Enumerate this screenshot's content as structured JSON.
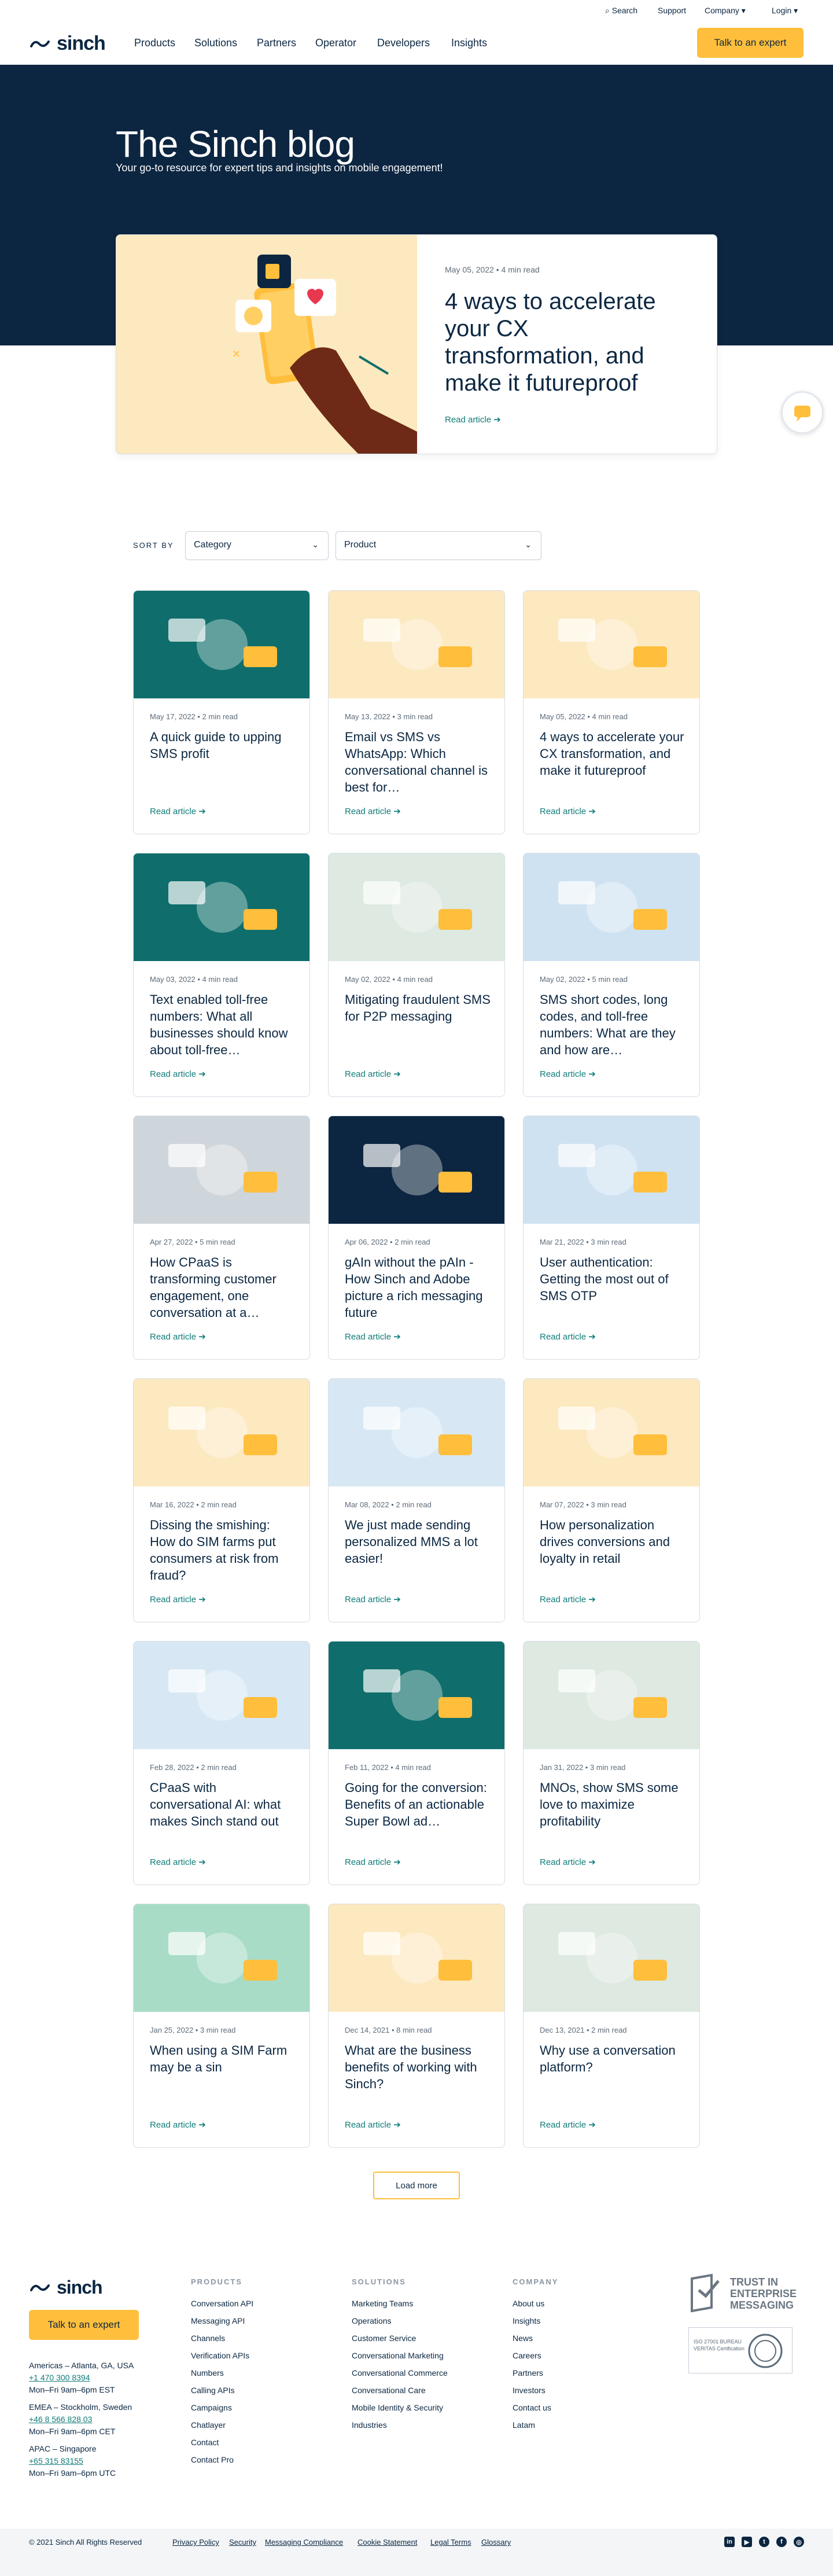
{
  "header": {
    "brand": "sinch",
    "utility": {
      "search": "Search",
      "support": "Support",
      "company": "Company",
      "login": "Login"
    },
    "nav": [
      "Products",
      "Solutions",
      "Partners",
      "Operator",
      "Developers",
      "Insights"
    ],
    "cta": "Talk to an expert"
  },
  "hero": {
    "title": "The Sinch blog",
    "subtitle": "Your go-to resource for expert tips and insights on mobile engagement!",
    "featured": {
      "meta": "May 05, 2022 • 4 min read",
      "title": "4 ways to accelerate your CX transformation, and make it futureproof",
      "read": "Read article"
    }
  },
  "sort": {
    "label": "SORT BY",
    "category": "Category",
    "product": "Product"
  },
  "cards": [
    {
      "meta": "May 17, 2022 • 2 min read",
      "title": "A quick guide to upping SMS profit",
      "read": "Read article",
      "bg": "#0f6e6b"
    },
    {
      "meta": "May 13, 2022 • 3 min read",
      "title": "Email vs SMS vs WhatsApp: Which conversational channel is best for…",
      "read": "Read article",
      "bg": "#fde9c0"
    },
    {
      "meta": "May 05, 2022 • 4 min read",
      "title": "4 ways to accelerate your CX transformation, and make it futureproof",
      "read": "Read article",
      "bg": "#fde9c0"
    },
    {
      "meta": "May 03, 2022 • 4 min read",
      "title": "Text enabled toll-free numbers: What all businesses should know about toll-free…",
      "read": "Read article",
      "bg": "#0f6e6b"
    },
    {
      "meta": "May 02, 2022 • 4 min read",
      "title": "Mitigating fraudulent SMS for P2P messaging",
      "read": "Read article",
      "bg": "#dde9e1"
    },
    {
      "meta": "May 02, 2022 • 5 min read",
      "title": "SMS short codes, long codes, and toll-free numbers: What are they and how are…",
      "read": "Read article",
      "bg": "#cfe2f1"
    },
    {
      "meta": "Apr 27, 2022 • 5 min read",
      "title": "How CPaaS is transforming customer engagement, one conversation at a…",
      "read": "Read article",
      "bg": "#cfd6db"
    },
    {
      "meta": "Apr 06, 2022 • 2 min read",
      "title": "gAIn without the pAIn - How Sinch and Adobe picture a rich messaging future",
      "read": "Read article",
      "bg": "#0c2540"
    },
    {
      "meta": "Mar 21, 2022 • 3 min read",
      "title": "User authentication: Getting the most out of SMS OTP",
      "read": "Read article",
      "bg": "#cfe2f1"
    },
    {
      "meta": "Mar 16, 2022 • 2 min read",
      "title": "Dissing the smishing: How do SIM farms put consumers at risk from fraud?",
      "read": "Read article",
      "bg": "#fde9c0"
    },
    {
      "meta": "Mar 08, 2022 • 2 min read",
      "title": "We just made sending personalized MMS a lot easier!",
      "read": "Read article",
      "bg": "#d7e8f4"
    },
    {
      "meta": "Mar 07, 2022 • 3 min read",
      "title": "How personalization drives conversions and loyalty in retail",
      "read": "Read article",
      "bg": "#fde9c0"
    },
    {
      "meta": "Feb 28, 2022 • 2 min read",
      "title": "CPaaS with conversational AI: what makes Sinch stand out",
      "read": "Read article",
      "bg": "#d7e8f4"
    },
    {
      "meta": "Feb 11, 2022 • 4 min read",
      "title": "Going for the conversion: Benefits of an actionable Super Bowl ad…",
      "read": "Read article",
      "bg": "#0f6e6b"
    },
    {
      "meta": "Jan 31, 2022 • 3 min read",
      "title": "MNOs, show SMS some love to maximize profitability",
      "read": "Read article",
      "bg": "#dde9e1"
    },
    {
      "meta": "Jan 25, 2022 • 3 min read",
      "title": "When using a SIM Farm may be a sin",
      "read": "Read article",
      "bg": "#a8dcc6"
    },
    {
      "meta": "Dec 14, 2021 • 8 min read",
      "title": "What are the business benefits of working with Sinch?",
      "read": "Read article",
      "bg": "#fde9c0"
    },
    {
      "meta": "Dec 13, 2021 • 2 min read",
      "title": "Why use a conversation platform?",
      "read": "Read article",
      "bg": "#dde9e1"
    }
  ],
  "load_more": "Load more",
  "footer": {
    "brand": "sinch",
    "cta": "Talk to an expert",
    "locations": [
      {
        "city": "Americas – Atlanta, GA, USA",
        "phone": "+1 470 300 8394",
        "hours": "Mon–Fri 9am–6pm EST"
      },
      {
        "city": "EMEA – Stockholm, Sweden",
        "phone": "+46 8 566 828 03",
        "hours": "Mon–Fri 9am–6pm CET"
      },
      {
        "city": "APAC – Singapore",
        "phone": "+65 315 83155",
        "hours": "Mon–Fri 9am–6pm UTC"
      }
    ],
    "columns": [
      {
        "heading": "PRODUCTS",
        "items": [
          "Conversation API",
          "Messaging API",
          "Channels",
          "Verification APIs",
          "Numbers",
          "Calling APIs",
          "Campaigns",
          "Chatlayer",
          "Contact",
          "Contact Pro"
        ]
      },
      {
        "heading": "SOLUTIONS",
        "items": [
          "Marketing Teams",
          "Operations",
          "Customer Service",
          "Conversational Marketing",
          "Conversational Commerce",
          "Conversational Care",
          "Mobile Identity & Security",
          "Industries"
        ]
      },
      {
        "heading": "COMPANY",
        "items": [
          "About us",
          "Insights",
          "News",
          "Careers",
          "Partners",
          "Investors",
          "Contact us",
          "Latam"
        ]
      }
    ],
    "trust": "TRUST IN ENTERPRISE MESSAGING",
    "cert": "ISO 27001 BUREAU VERITAS Certification",
    "copyright": "© 2021 Sinch All Rights Reserved",
    "legal": [
      "Privacy Policy",
      "Security",
      "Messaging Compliance",
      "Cookie Statement",
      "Legal Terms",
      "Glossary"
    ],
    "social": [
      "in",
      "yt",
      "tw",
      "fb",
      "ig"
    ]
  }
}
